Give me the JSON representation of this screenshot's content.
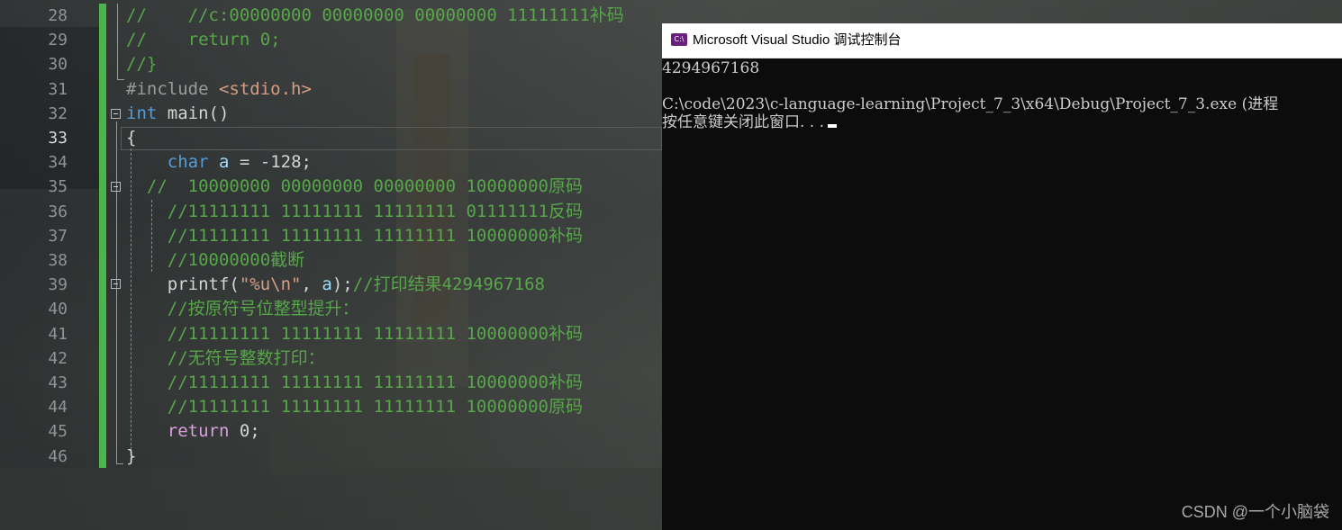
{
  "editor": {
    "active_line": "33",
    "lines": [
      {
        "num": "28",
        "parts": [
          [
            "cm",
            "//    //c:00000000 00000000 00000000 11111111补码"
          ]
        ]
      },
      {
        "num": "29",
        "parts": [
          [
            "cm",
            "//    return 0;"
          ]
        ]
      },
      {
        "num": "30",
        "parts": [
          [
            "cm",
            "//}"
          ]
        ]
      },
      {
        "num": "31",
        "parts": [
          [
            "pp",
            "#include "
          ],
          [
            "inc",
            "<stdio.h>"
          ]
        ]
      },
      {
        "num": "32",
        "parts": [
          [
            "kw",
            "int"
          ],
          [
            "",
            " main()"
          ]
        ]
      },
      {
        "num": "33",
        "parts": [
          [
            "",
            "{"
          ]
        ]
      },
      {
        "num": "34",
        "parts": [
          [
            "",
            "    "
          ],
          [
            "kw",
            "char"
          ],
          [
            "",
            " "
          ],
          [
            "var",
            "a"
          ],
          [
            "",
            " = -128;"
          ]
        ]
      },
      {
        "num": "35",
        "parts": [
          [
            "cm",
            "  //  10000000 00000000 00000000 10000000原码"
          ]
        ]
      },
      {
        "num": "36",
        "parts": [
          [
            "cm",
            "    //11111111 11111111 11111111 01111111反码"
          ]
        ]
      },
      {
        "num": "37",
        "parts": [
          [
            "cm",
            "    //11111111 11111111 11111111 10000000补码"
          ]
        ]
      },
      {
        "num": "38",
        "parts": [
          [
            "cm",
            "    //10000000截断"
          ]
        ]
      },
      {
        "num": "39",
        "parts": [
          [
            "",
            "    printf("
          ],
          [
            "str",
            "\"%u\\n\""
          ],
          [
            "",
            ", "
          ],
          [
            "var",
            "a"
          ],
          [
            "",
            ");"
          ],
          [
            "cm",
            "//打印结果4294967168"
          ]
        ]
      },
      {
        "num": "40",
        "parts": [
          [
            "cm",
            "    //按原符号位整型提升："
          ]
        ]
      },
      {
        "num": "41",
        "parts": [
          [
            "cm",
            "    //11111111 11111111 11111111 10000000补码"
          ]
        ]
      },
      {
        "num": "42",
        "parts": [
          [
            "cm",
            "    //无符号整数打印："
          ]
        ]
      },
      {
        "num": "43",
        "parts": [
          [
            "cm",
            "    //11111111 11111111 11111111 10000000补码"
          ]
        ]
      },
      {
        "num": "44",
        "parts": [
          [
            "cm",
            "    //11111111 11111111 11111111 10000000原码"
          ]
        ]
      },
      {
        "num": "45",
        "parts": [
          [
            "",
            "    "
          ],
          [
            "kw2",
            "return"
          ],
          [
            "",
            " 0;"
          ]
        ]
      },
      {
        "num": "46",
        "parts": [
          [
            "",
            "}"
          ]
        ]
      }
    ]
  },
  "console": {
    "icon_label": "C:\\",
    "title": "Microsoft Visual Studio 调试控制台",
    "output": "4294967168",
    "exit_line": "C:\\code\\2023\\c-language-learning\\Project_7_3\\x64\\Debug\\Project_7_3.exe (进程",
    "prompt": "按任意键关闭此窗口. . ."
  },
  "watermark": "CSDN @一个小脑袋"
}
